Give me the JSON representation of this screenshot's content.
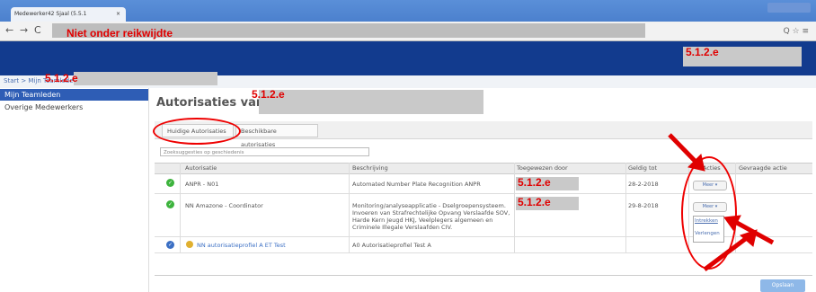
{
  "browser": {
    "tab_title": "Medewerker42 Sjaal (5.5.1",
    "tab_close": "×",
    "back": "←",
    "forward": "→",
    "reload": "C",
    "address_label": "Niet onder reikwijdte",
    "toolbar_icons": "Q ☆ ≡"
  },
  "header": {
    "redaction_code": "5.1.2.e"
  },
  "breadcrumb": {
    "text": "Start > Mijn Teamleden >",
    "redaction_code": "5.1.2.e"
  },
  "sidebar": {
    "items": [
      {
        "label": "Mijn Teamleden"
      },
      {
        "label": "Overige Medewerkers"
      }
    ]
  },
  "page": {
    "title": "Autorisaties van:",
    "redaction_code": "5.1.2.e"
  },
  "tabs": [
    {
      "label": "Huidige Autorisaties"
    },
    {
      "label": "Beschikbare autorisaties"
    }
  ],
  "filter": {
    "placeholder": "Zoeksuggesties op geschiedenis"
  },
  "table": {
    "columns": [
      "Autorisatie",
      "Beschrijving",
      "Toegewezen door",
      "Geldig tot",
      "Acties",
      "Gevraagde actie"
    ],
    "rows": [
      {
        "autorisatie": "ANPR - N01",
        "beschrijving": "Automated Number Plate Recognition ANPR",
        "toegewezen": "5.1.2.e",
        "geldig": "28-2-2018",
        "actie": "Meer"
      },
      {
        "autorisatie": "NN Amazone - Coordinator",
        "beschrijving_lines": [
          "Monitoring/analyseapplicatie - Dselgroepensysteem.",
          "Invoeren van Strafrechtelijke Opvang Verslaafde SOV,",
          "Harde Kern Jeugd HKJ, Veelplegers algemeen en",
          "Criminele Illegale Verslaafden CIV."
        ],
        "toegewezen": "5.1.2.e",
        "geldig": "29-8-2018",
        "actie": "Meer"
      },
      {
        "autorisatie": "NN autorisatieprofiel A ET Test",
        "beschrijving": "A0 Autorisatieprofiel Test A",
        "toegewezen": "",
        "geldig": "",
        "actie": ""
      }
    ],
    "menu_items": [
      "Intrekken",
      "Verlengen"
    ]
  },
  "footer": {
    "save_label": "Opslaan"
  },
  "colors": {
    "accent": "#123b8e",
    "annotation": "#e00000",
    "sidebar_active": "#2e5db5"
  }
}
